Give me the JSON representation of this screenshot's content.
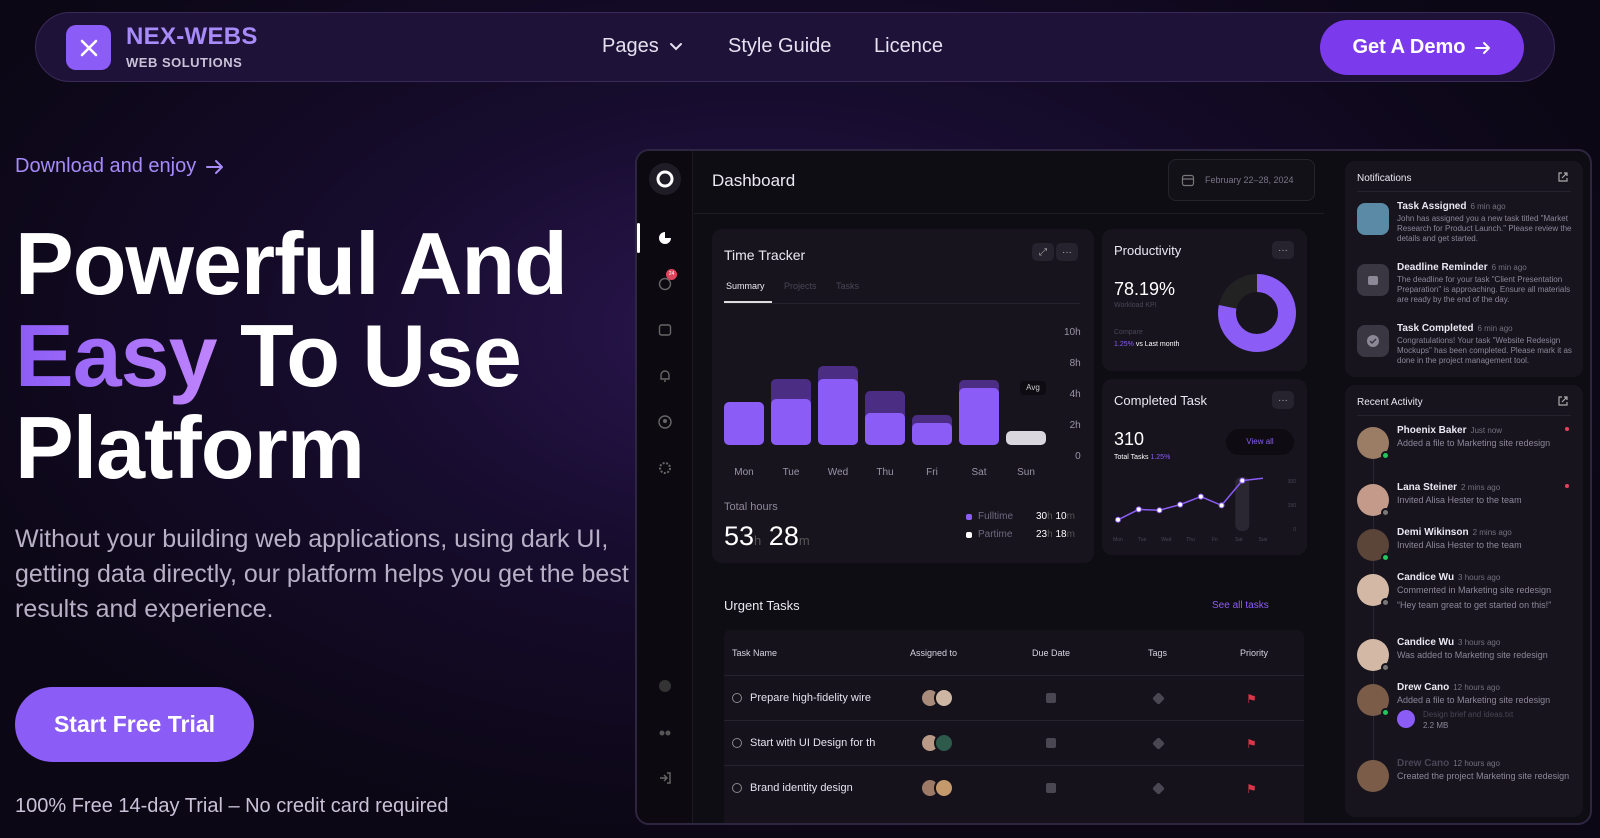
{
  "brand": {
    "name": "NEX-WEBS",
    "tagline": "WEB SOLUTIONS"
  },
  "nav": {
    "items": [
      "Pages",
      "Style Guide",
      "Licence"
    ],
    "cta": "Get A Demo"
  },
  "hero": {
    "eyebrow": "Download and enjoy",
    "title_line1": "Powerful And",
    "title_accent": "Easy",
    "title_line2_rest": " To Use",
    "title_line3": "Platform",
    "description": "Without your building web applications, using dark UI, getting data directly, our platform helps you get the best results and experience.",
    "cta": "Start Free Trial",
    "note": "100% Free 14-day Trial – No credit card required"
  },
  "dashboard": {
    "title": "Dashboard",
    "date_range": "February 22–28, 2024",
    "time_tracker": {
      "title": "Time Tracker",
      "tabs": [
        "Summary",
        "Projects",
        "Tasks"
      ],
      "y_ticks": [
        "10h",
        "8h",
        "4h",
        "2h",
        "0"
      ],
      "avg_label": "Avg",
      "days": [
        "Mon",
        "Tue",
        "Wed",
        "Thu",
        "Fri",
        "Sat",
        "Sun"
      ],
      "total_label": "Total hours",
      "total_h": "53",
      "total_m": "28",
      "h": "h",
      "m": "m",
      "fulltime_label": "Fulltime",
      "fulltime": "30h 10m",
      "fulltime_h": "30",
      "fulltime_m": "10",
      "partime_label": "Partime",
      "partime_h": "23",
      "partime_m": "18",
      "chart_data": {
        "type": "bar",
        "categories": [
          "Mon",
          "Tue",
          "Wed",
          "Thu",
          "Fri",
          "Sat",
          "Sun"
        ],
        "series": [
          {
            "values": [
              3.4,
              3.6,
              5.2,
              2.5,
              1.7,
              4.5,
              0.6
            ]
          },
          {
            "values": [
              2.5,
              5.2,
              6.2,
              4.3,
              2.4,
              5.1,
              0
            ]
          }
        ],
        "ylim": [
          0,
          10.5
        ]
      }
    },
    "productivity": {
      "title": "Productivity",
      "value": "78.19%",
      "sub": "Workload KPI",
      "compare": "Compare",
      "change": "1.25%",
      "change_note": "vs Last month",
      "percent": 78.19
    },
    "completed": {
      "title": "Completed Task",
      "value": "310",
      "sub": "Total Tasks",
      "change": "1.25%",
      "view_all": "View all",
      "y_ticks": [
        "300",
        "150",
        "0"
      ],
      "days": [
        "Mon",
        "Tue",
        "Wed",
        "Thu",
        "Fri",
        "Sat",
        "Sun"
      ],
      "chart_data": {
        "type": "line",
        "x": [
          "Mon",
          "Mon",
          "Tue",
          "Wed",
          "Thu",
          "Fri",
          "Sat",
          "Sun"
        ],
        "y": [
          45,
          110,
          105,
          140,
          190,
          135,
          290,
          305
        ],
        "ylim": [
          0,
          300
        ]
      }
    },
    "urgent": {
      "title": "Urgent Tasks",
      "see_all": "See all tasks",
      "columns": [
        "Task Name",
        "Assigned to",
        "Due Date",
        "Tags",
        "Priority"
      ],
      "rows": [
        {
          "name": "Prepare high-fidelity wire"
        },
        {
          "name": "Start with UI Design for th"
        },
        {
          "name": "Brand identity design"
        }
      ]
    },
    "notifications": {
      "title": "Notifications",
      "items": [
        {
          "title": "Task Assigned",
          "time": "6 min ago",
          "body": "John has assigned you a new task titled \"Market Research for Product Launch.\" Please review the details and get started."
        },
        {
          "title": "Deadline Reminder",
          "time": "6 min ago",
          "body": "The deadline for your task \"Client Presentation Preparation\" is approaching. Ensure all materials are ready by the end of the day."
        },
        {
          "title": "Task Completed",
          "time": "6 min ago",
          "body": "Congratulations! Your task \"Website Redesign Mockups\" has been completed. Please mark it as done in the project management tool."
        }
      ]
    },
    "activity": {
      "title": "Recent Activity",
      "items": [
        {
          "name": "Phoenix Baker",
          "time": "Just now",
          "body": "Added a file to Marketing site redesign"
        },
        {
          "name": "Lana Steiner",
          "time": "2 mins ago",
          "body": "Invited Alisa Hester to the team"
        },
        {
          "name": "Demi Wikinson",
          "time": "2 mins ago",
          "body": "Invited Alisa Hester to the team"
        },
        {
          "name": "Candice Wu",
          "time": "3 hours ago",
          "body": "Commented in Marketing site redesign",
          "quote": "“Hey team great to get started on this!”"
        },
        {
          "name": "Candice Wu",
          "time": "3 hours ago",
          "body": "Was added to Marketing site redesign"
        },
        {
          "name": "Drew Cano",
          "time": "12 hours ago",
          "body": "Added a file to Marketing site redesign",
          "file": "Design brief and ideas.txt",
          "file_size": "2.2 MB"
        },
        {
          "name": "Drew Cano",
          "time": "12 hours ago",
          "body": "Created the project Marketing site redesign"
        }
      ]
    },
    "sidebar_badge": "24"
  },
  "colors": {
    "accent": "#8b5cf6",
    "bg": "#140b26"
  }
}
